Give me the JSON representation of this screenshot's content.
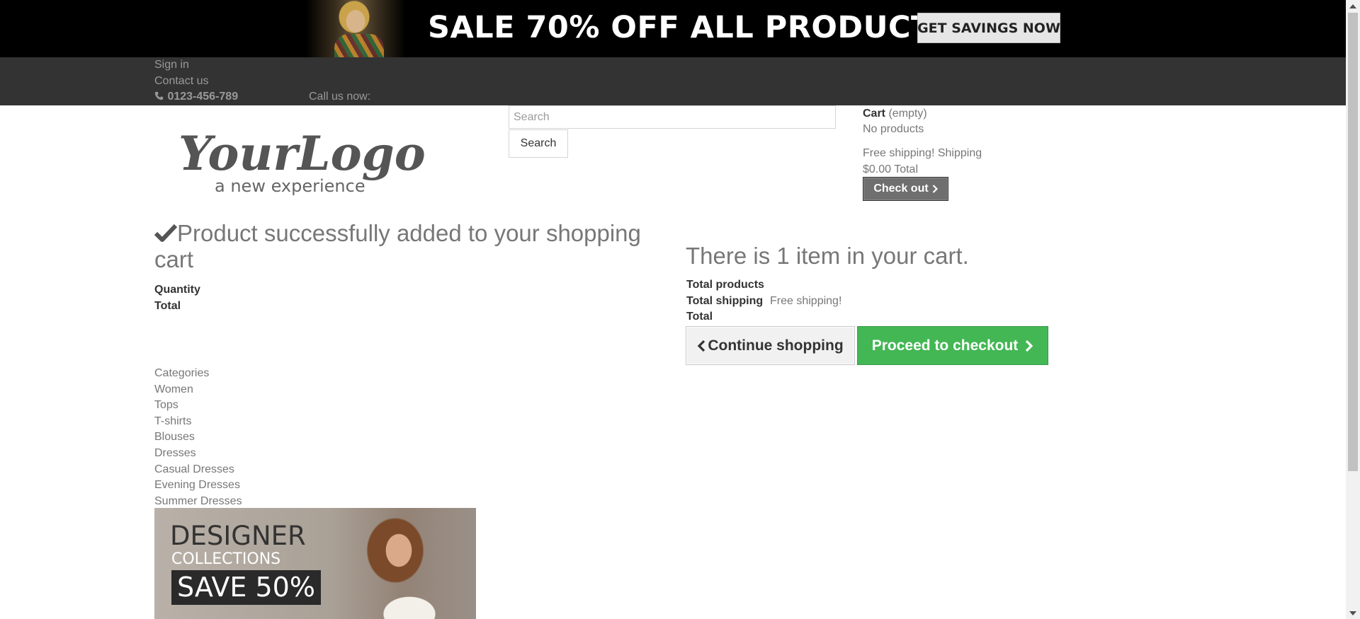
{
  "top_banner": {
    "headline": "SALE 70% OFF ALL PRODUCTS",
    "cta_label": "GET SAVINGS NOW"
  },
  "nav": {
    "sign_in": "Sign in",
    "contact_us": "Contact us",
    "call_prefix": "Call us now:",
    "phone": "0123-456-789"
  },
  "logo": {
    "main": "YourLogo",
    "tagline": "a new experience"
  },
  "search": {
    "placeholder": "Search",
    "button_label": "Search"
  },
  "header_cart": {
    "title": "Cart",
    "status": "(empty)",
    "no_products": "No products",
    "free_shipping": "Free shipping!",
    "shipping_label": "Shipping",
    "total_value": "$0.00",
    "total_label": "Total",
    "checkout_label": "Check out"
  },
  "confirmation": {
    "title": "Product successfully added to your shopping cart",
    "quantity_label": "Quantity",
    "total_label": "Total"
  },
  "cart_summary": {
    "count_text": "There is 1 item in your cart.",
    "total_products_label": "Total products",
    "total_shipping_label": "Total shipping",
    "total_shipping_value": "Free shipping!",
    "total_label": "Total",
    "continue_label": "Continue shopping",
    "proceed_label": "Proceed to checkout"
  },
  "categories": [
    "Categories",
    "Women",
    "Tops",
    "T-shirts",
    "Blouses",
    "Dresses",
    "Casual Dresses",
    "Evening Dresses",
    "Summer Dresses"
  ],
  "designer_banner": {
    "line1": "DESIGNER",
    "line2": "COLLECTIONS",
    "badge": "SAVE 50%"
  },
  "colors": {
    "banner_bg": "#000000",
    "nav_bg": "#333333",
    "proceed_green": "#43b754",
    "checkout_grey": "#6f6f6f",
    "text_grey": "#777777"
  }
}
